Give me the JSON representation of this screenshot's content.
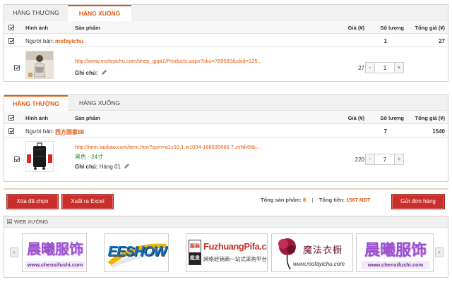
{
  "cart1": {
    "tabs": [
      {
        "label": "HÀNG THƯỜNG"
      },
      {
        "label": "HÀNG XUỐNG"
      }
    ],
    "headers": {
      "image": "Hình ảnh",
      "product": "Sản phẩm",
      "price": "Giá (¥)",
      "qty": "Số lượng",
      "total": "Tổng giá (¥)"
    },
    "seller": {
      "label": "Người bán:",
      "name": "mofayichu",
      "qty": "1",
      "total": "27"
    },
    "item": {
      "link": "http://www.mofayichu.com/shop_gjqa1/Products.aspx?sku=789560&sbid=125...",
      "note_label": "Ghi chú:",
      "note_value": "",
      "price": "27",
      "qty": "1",
      "minus": "-",
      "plus": "+"
    }
  },
  "cart2": {
    "tabs": [
      {
        "label": "HÀNG THƯỜNG"
      },
      {
        "label": "HÀNG XUỐNG"
      }
    ],
    "headers": {
      "image": "Hình ảnh",
      "product": "Sản phẩm",
      "price": "Giá (¥)",
      "qty": "Số lượng",
      "total": "Tổng giá (¥)"
    },
    "seller": {
      "label": "Người bán:",
      "name": "西方国家88",
      "qty": "7",
      "total": "1540"
    },
    "item": {
      "link": "http://item.taobao.com/item.htm?spm=a1z10.1.w1004-166530665.7.zvNh0f&i...",
      "variant": "黑色 - 24寸",
      "note_label": "Ghi chú:",
      "note_value": "Hàng 01",
      "price": "220",
      "qty": "7",
      "minus": "-",
      "plus": "+"
    }
  },
  "actions": {
    "delete": "Xóa đã chọn",
    "export": "Xuất ra Excel",
    "total_products_label": "Tổng sản phẩm:",
    "total_products": "8",
    "separator": "|",
    "total_money_label": "Tổng tiền:",
    "total_money": "1567 NDT",
    "submit": "Gửi đơn hàng"
  },
  "web": {
    "title": "WEB XƯỞNG",
    "prev": "‹",
    "next": "›",
    "logos": [
      {
        "name": "晨曦服饰",
        "url": "www.chenxifushi.com"
      },
      {
        "name": "EESHOW"
      },
      {
        "name": "FuzhuangPifa.cn",
        "badge_top": "服装",
        "badge_bottom": "批发",
        "sub": "网络经销商一站式采购平台"
      },
      {
        "name": "魔法衣橱",
        "url": "www.mofayichu.com"
      },
      {
        "name": "晨曦服饰",
        "url": "www.chenxifushi.com"
      }
    ]
  },
  "colors": {
    "accent": "#e8570c",
    "button_red": "#c9302c",
    "green": "#2a8a2a"
  }
}
